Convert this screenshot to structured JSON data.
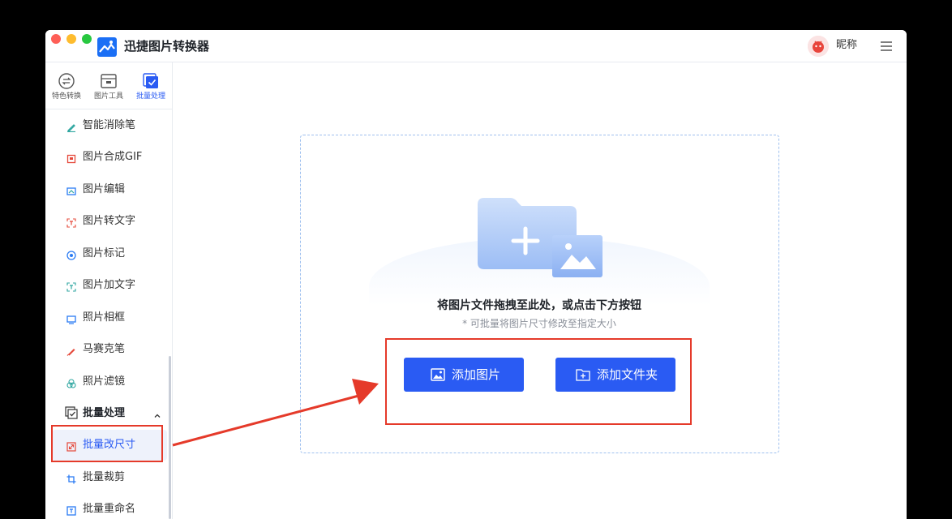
{
  "app": {
    "title": "迅捷图片转换器",
    "nickname": "昵称"
  },
  "colors": {
    "accent": "#2a5bf3",
    "highlight": "#e53a2a",
    "dashed_border": "#9fc0ef"
  },
  "topnav": [
    {
      "label": "特色转换",
      "icon": "convert-icon",
      "active": false
    },
    {
      "label": "图片工具",
      "icon": "image-tools-icon",
      "active": false
    },
    {
      "label": "批量处理",
      "icon": "batch-icon",
      "active": true
    }
  ],
  "sidebar": {
    "items": [
      {
        "label": "智能消除笔",
        "icon": "eraser-pen-icon",
        "color": "#2ea6a0"
      },
      {
        "label": "图片合成GIF",
        "icon": "gif-icon",
        "color": "#e5483a"
      },
      {
        "label": "图片编辑",
        "icon": "edit-image-icon",
        "color": "#2a7bf3"
      },
      {
        "label": "图片转文字",
        "icon": "ocr-icon",
        "color": "#e5483a"
      },
      {
        "label": "图片标记",
        "icon": "mark-icon",
        "color": "#2a7bf3"
      },
      {
        "label": "图片加文字",
        "icon": "add-text-icon",
        "color": "#2ea6a0"
      },
      {
        "label": "照片相框",
        "icon": "frame-icon",
        "color": "#2a7bf3"
      },
      {
        "label": "马赛克笔",
        "icon": "mosaic-pen-icon",
        "color": "#e5483a"
      },
      {
        "label": "照片滤镜",
        "icon": "filter-icon",
        "color": "#2ea6a0"
      }
    ],
    "group": {
      "label": "批量处理",
      "icon": "batch-group-icon",
      "expanded": true
    },
    "group_items": [
      {
        "label": "批量改尺寸",
        "icon": "resize-icon",
        "selected": true
      },
      {
        "label": "批量裁剪",
        "icon": "crop-icon",
        "selected": false
      },
      {
        "label": "批量重命名",
        "icon": "rename-icon",
        "selected": false
      }
    ]
  },
  "dropzone": {
    "title": "将图片文件拖拽至此处，或点击下方按钮",
    "subtitle": "* 可批量将图片尺寸修改至指定大小",
    "add_image_label": "添加图片",
    "add_folder_label": "添加文件夹"
  }
}
